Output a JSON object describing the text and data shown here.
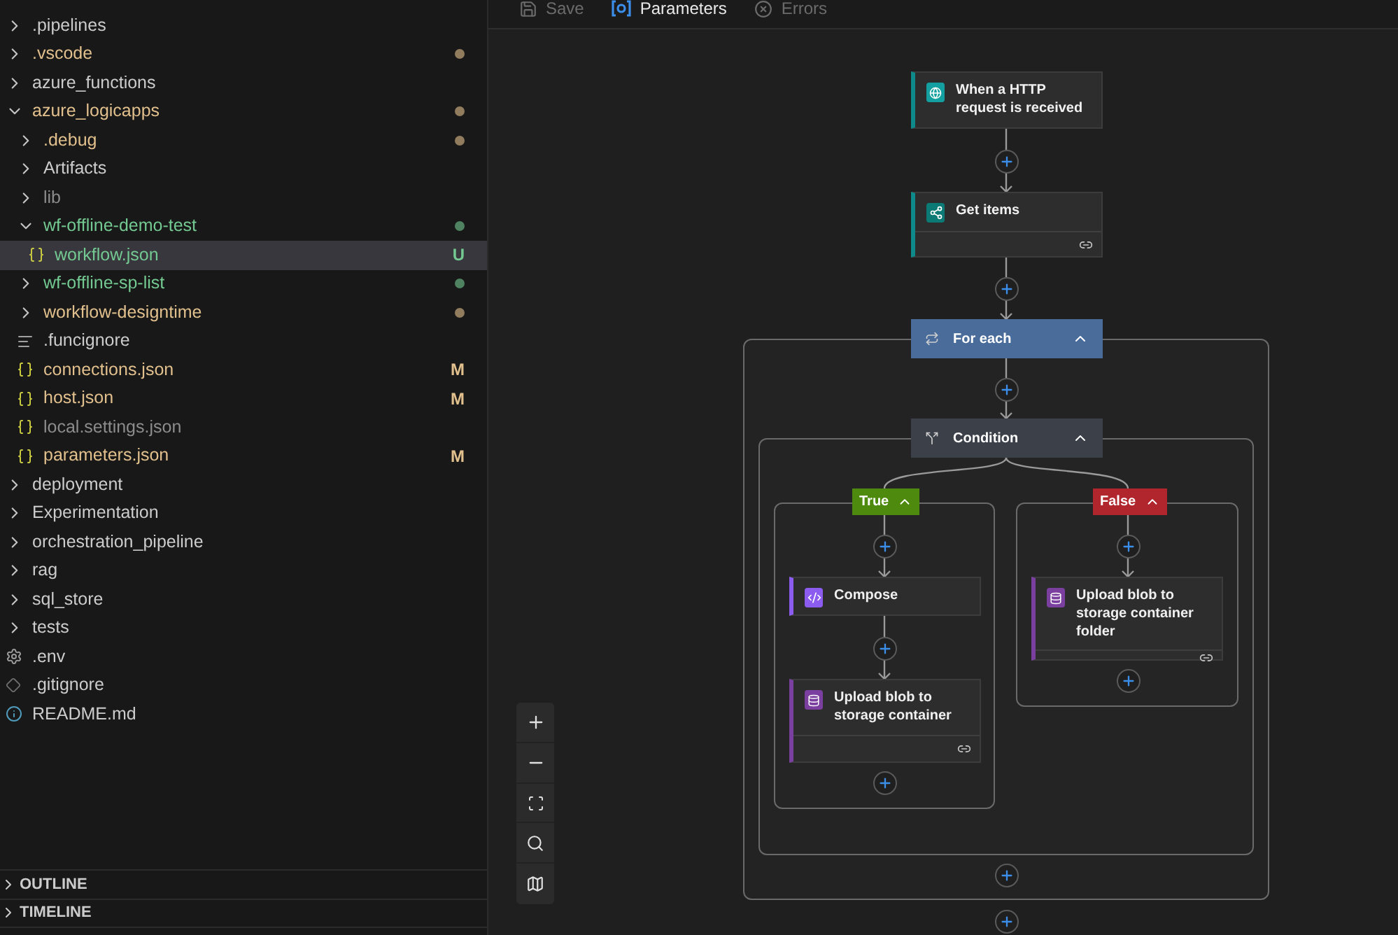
{
  "explorer": {
    "items": [
      {
        "kind": "folder",
        "name": ".pipelines",
        "expanded": false,
        "dot": false
      },
      {
        "kind": "folder",
        "name": ".vscode",
        "expanded": false,
        "dot": true,
        "color": "#e2c08d"
      },
      {
        "kind": "folder",
        "name": "azure_functions",
        "expanded": false,
        "dot": false
      },
      {
        "kind": "folder",
        "name": "azure_logicapps",
        "expanded": true,
        "dot": true,
        "color": "#e2c08d",
        "children": [
          {
            "kind": "folder",
            "name": ".debug",
            "expanded": false,
            "dot": true,
            "color": "#e2c08d"
          },
          {
            "kind": "folder",
            "name": "Artifacts",
            "expanded": false,
            "dot": false
          },
          {
            "kind": "folder",
            "name": "lib",
            "expanded": false,
            "dot": false,
            "color": "#8c8c8c"
          },
          {
            "kind": "folder",
            "name": "wf-offline-demo-test",
            "expanded": true,
            "dot": true,
            "color": "#73c991",
            "children": [
              {
                "kind": "json",
                "name": "workflow.json",
                "color": "#73c991",
                "badge": "U",
                "selected": true
              }
            ]
          },
          {
            "kind": "folder",
            "name": "wf-offline-sp-list",
            "expanded": false,
            "dot": true,
            "color": "#73c991"
          },
          {
            "kind": "folder",
            "name": "workflow-designtime",
            "expanded": false,
            "dot": true,
            "color": "#e2c08d"
          },
          {
            "kind": "text",
            "name": ".funcignore",
            "selected": false
          },
          {
            "kind": "json",
            "name": "connections.json",
            "color": "#e2c08d",
            "badge": "M",
            "selected": false
          },
          {
            "kind": "json",
            "name": "host.json",
            "color": "#e2c08d",
            "badge": "M",
            "selected": false
          },
          {
            "kind": "json",
            "name": "local.settings.json",
            "color": "#8c8c8c",
            "selected": false
          },
          {
            "kind": "json",
            "name": "parameters.json",
            "color": "#e2c08d",
            "badge": "M",
            "selected": false
          }
        ]
      },
      {
        "kind": "folder",
        "name": "deployment",
        "expanded": false,
        "dot": false
      },
      {
        "kind": "folder",
        "name": "Experimentation",
        "expanded": false,
        "dot": false
      },
      {
        "kind": "folder",
        "name": "orchestration_pipeline",
        "expanded": false,
        "dot": false
      },
      {
        "kind": "folder",
        "name": "rag",
        "expanded": false,
        "dot": false
      },
      {
        "kind": "folder",
        "name": "sql_store",
        "expanded": false,
        "dot": false
      },
      {
        "kind": "folder",
        "name": "tests",
        "expanded": false,
        "dot": false
      },
      {
        "kind": "settings",
        "name": ".env",
        "selected": false
      },
      {
        "kind": "git",
        "name": ".gitignore",
        "selected": false
      },
      {
        "kind": "readme",
        "name": "README.md",
        "selected": false
      }
    ]
  },
  "panels": [
    {
      "title": "OUTLINE",
      "expanded": false
    },
    {
      "title": "TIMELINE",
      "expanded": false
    }
  ],
  "toolbar": [
    {
      "kind": "save",
      "label": "Save",
      "disabled": true
    },
    {
      "kind": "parameters",
      "label": "Parameters",
      "disabled": false
    },
    {
      "kind": "errors",
      "label": "Errors",
      "disabled": true
    }
  ],
  "workflow": {
    "trigger": {
      "title": "When a HTTP request is received",
      "kind": "request"
    },
    "get_items": {
      "title": "Get items",
      "kind": "sharepoint"
    },
    "foreach": {
      "title": "For each",
      "expanded": true
    },
    "condition": {
      "title": "Condition",
      "expanded": true
    },
    "branches": [
      {
        "label": "True",
        "expanded": true,
        "color": "#4e8a0e",
        "actions": [
          {
            "title": "Compose",
            "kind": "compose"
          },
          {
            "title": "Upload blob to storage container",
            "kind": "blob"
          }
        ]
      },
      {
        "label": "False",
        "expanded": true,
        "color": "#b0262c",
        "actions": [
          {
            "title": "Upload blob to storage container folder",
            "kind": "blob"
          }
        ]
      }
    ]
  }
}
